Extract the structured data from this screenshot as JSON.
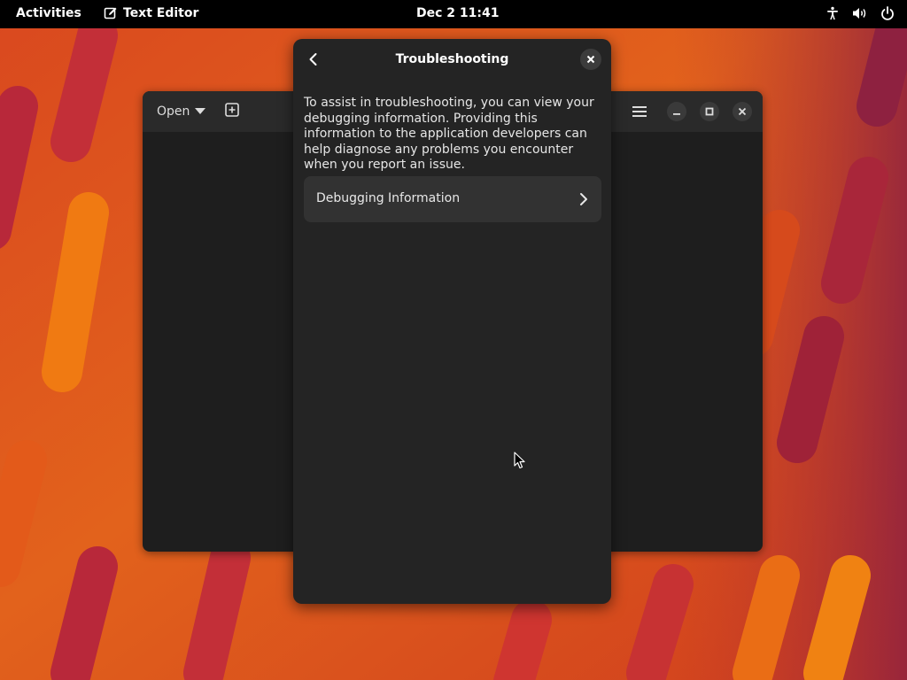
{
  "topbar": {
    "activities": "Activities",
    "app_name": "Text Editor",
    "app_icon": "text-editor-icon",
    "clock": "Dec 2  11:41",
    "tray_icons": [
      "accessibility-icon",
      "volume-icon",
      "power-icon"
    ]
  },
  "editor": {
    "open_label": "Open",
    "icons": [
      "new-tab-icon",
      "hamburger-menu-icon",
      "minimize-icon",
      "maximize-icon",
      "close-icon"
    ]
  },
  "dialog": {
    "title": "Troubleshooting",
    "description": "To assist in troubleshooting, you can view your debugging information. Providing this information to the application developers can help diagnose any problems you encounter when you report an issue.",
    "row_label": "Debugging Information",
    "icons": [
      "back-arrow-icon",
      "close-icon",
      "chevron-right-icon"
    ]
  },
  "colors": {
    "topbar": "#000000",
    "window": "#1e1e1e",
    "headerbar": "#2a2a2a",
    "dialog": "#242424",
    "row": "#323232",
    "wallpaper_orange": "#e8600f",
    "wallpaper_red": "#b8283a"
  }
}
